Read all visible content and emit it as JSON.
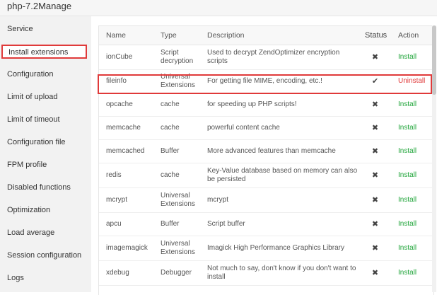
{
  "window": {
    "title": "php-7.2Manage"
  },
  "sidebar": {
    "items": [
      {
        "label": "Service"
      },
      {
        "label": "Install extensions"
      },
      {
        "label": "Configuration"
      },
      {
        "label": "Limit of upload"
      },
      {
        "label": "Limit of timeout"
      },
      {
        "label": "Configuration file"
      },
      {
        "label": "FPM profile"
      },
      {
        "label": "Disabled functions"
      },
      {
        "label": "Optimization"
      },
      {
        "label": "Load average"
      },
      {
        "label": "Session configuration"
      },
      {
        "label": "Logs"
      }
    ]
  },
  "table": {
    "headers": {
      "name": "Name",
      "type": "Type",
      "description": "Description",
      "status": "Status",
      "action": "Action"
    },
    "rows": [
      {
        "name": "ionCube",
        "type": "Script decryption",
        "description": "Used to decrypt ZendOptimizer encryption scripts",
        "status": "✖",
        "action": "Install"
      },
      {
        "name": "fileinfo",
        "type": "Universal Extensions",
        "description": "For getting file MIME, encoding, etc.!",
        "status": "✔",
        "action": "Uninstall"
      },
      {
        "name": "opcache",
        "type": "cache",
        "description": "for speeding up PHP scripts!",
        "status": "✖",
        "action": "Install"
      },
      {
        "name": "memcache",
        "type": "cache",
        "description": "powerful content cache",
        "status": "✖",
        "action": "Install"
      },
      {
        "name": "memcached",
        "type": "Buffer",
        "description": "More advanced features than memcache",
        "status": "✖",
        "action": "Install"
      },
      {
        "name": "redis",
        "type": "cache",
        "description": "Key-Value database based on memory can also be persisted",
        "status": "✖",
        "action": "Install"
      },
      {
        "name": "mcrypt",
        "type": "Universal Extensions",
        "description": "mcrypt",
        "status": "✖",
        "action": "Install"
      },
      {
        "name": "apcu",
        "type": "Buffer",
        "description": "Script buffer",
        "status": "✖",
        "action": "Install"
      },
      {
        "name": "imagemagick",
        "type": "Universal Extensions",
        "description": "Imagick High Performance Graphics Library",
        "status": "✖",
        "action": "Install"
      },
      {
        "name": "xdebug",
        "type": "Debugger",
        "description": "Not much to say, don't know if you don't want to install",
        "status": "✖",
        "action": "Install"
      }
    ]
  },
  "colors": {
    "install": "#20a53a",
    "uninstall": "#e03a3a",
    "highlight": "#e03a3a"
  }
}
